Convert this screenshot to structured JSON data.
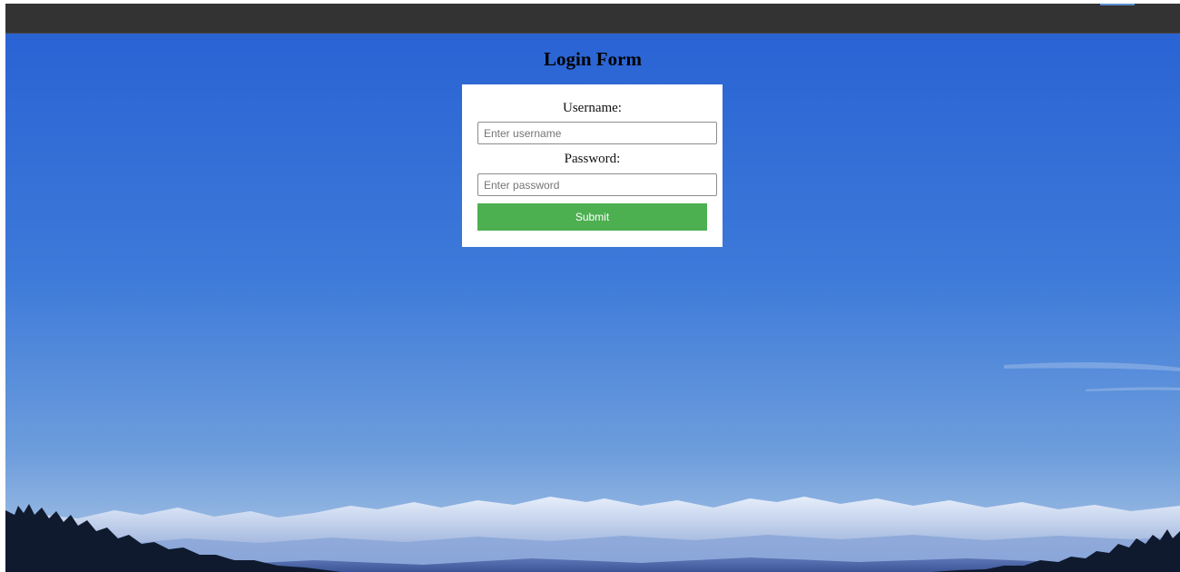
{
  "page": {
    "title": "Login Form"
  },
  "form": {
    "username_label": "Username:",
    "username_placeholder": "Enter username",
    "password_label": "Password:",
    "password_placeholder": "Enter password",
    "submit_label": "Submit"
  },
  "colors": {
    "topbar": "#333333",
    "sky_top": "#2a63d4",
    "sky_horizon": "#8fb4e2",
    "submit_button": "#4caf50",
    "card_background": "#ffffff"
  }
}
